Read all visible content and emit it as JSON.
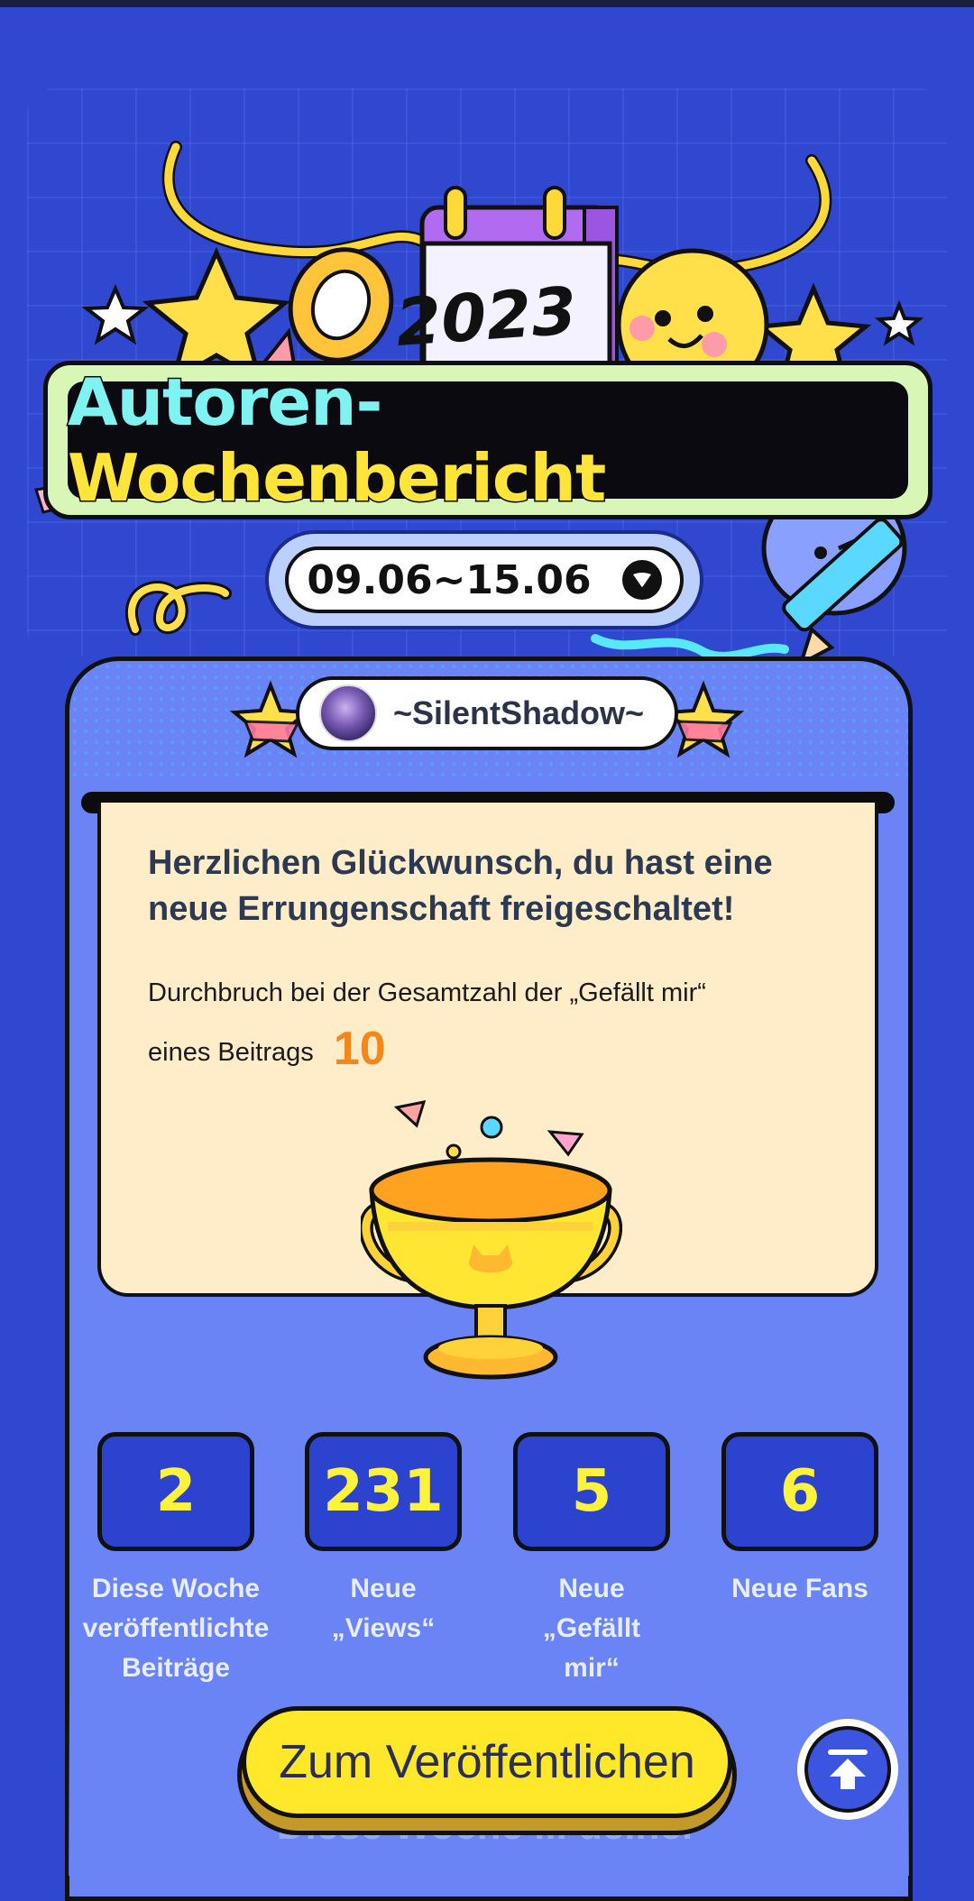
{
  "header": {
    "year": "2023",
    "title_part1": "Autoren-",
    "title_part2": "Wochenbericht",
    "date_range": "09.06~15.06"
  },
  "user": {
    "name": "~SilentShadow~"
  },
  "achievement": {
    "heading": "Herzlichen Glückwunsch, du hast eine neue Errungenschaft freigeschaltet!",
    "description_line1": "Durchbruch bei der Gesamtzahl der „Gefällt mir“",
    "description_line2": "eines Beitrags",
    "value": "10"
  },
  "stats": [
    {
      "value": "2",
      "label": "Diese Woche veröffentlichte Beiträge"
    },
    {
      "value": "231",
      "label": "Neue „Views“"
    },
    {
      "value": "5",
      "label": "Neue „Gefällt mir“"
    },
    {
      "value": "6",
      "label": "Neue Fans"
    }
  ],
  "footer": {
    "publish_label": "Zum Veröffentlichen",
    "fade_text": "Diese Woche ... deiner"
  },
  "icons": {
    "dropdown": "chevron-down-icon",
    "back_to_top": "arrow-up-icon"
  },
  "colors": {
    "background": "#2f48cf",
    "card": "#6a83f5",
    "accent_yellow": "#ffe82a",
    "accent_orange": "#f3871b",
    "note_bg": "#feedc8"
  }
}
